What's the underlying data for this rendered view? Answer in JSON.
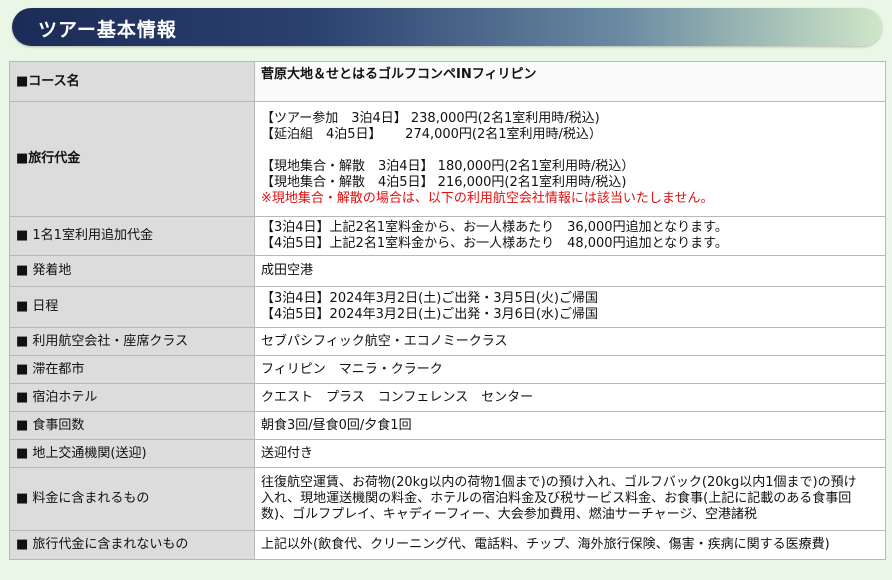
{
  "header": {
    "title": "ツアー基本情報"
  },
  "rows": {
    "course": {
      "label": "■コース名",
      "value": "菅原大地＆せとはるゴルフコンペINフィリピン"
    },
    "price": {
      "label": "■旅行代金",
      "lines": [
        "【ツアー参加　3泊4日】 238,000円(2名1室利用時/税込)",
        "【延泊組　4泊5日】　 　274,000円(2名1室利用時/税込）",
        "【現地集合・解散　3泊4日】 180,000円(2名1室利用時/税込）",
        "【現地集合・解散　4泊5日】 216,000円(2名1室利用時/税込)"
      ],
      "note": "※現地集合・解散の場合は、以下の利用航空会社情報には該当いたしません。"
    },
    "single": {
      "label": "■ 1名1室利用追加代金",
      "lines": [
        "【3泊4日】上記2名1室料金から、お一人様あたり　36,000円追加となります。",
        "【4泊5日】上記2名1室料金から、お一人様あたり　48,000円追加となります。"
      ]
    },
    "departure": {
      "label": "■ 発着地",
      "value": "成田空港"
    },
    "schedule": {
      "label": "■ 日程",
      "lines": [
        "【3泊4日】2024年3月2日(土)ご出発・3月5日(火)ご帰国",
        "【4泊5日】2024年3月2日(土)ご出発・3月6日(水)ご帰国"
      ]
    },
    "airline": {
      "label": "■ 利用航空会社・座席クラス",
      "value": "セブパシフィック航空・エコノミークラス"
    },
    "city": {
      "label": "■ 滞在都市",
      "value": "フィリピン　マニラ・クラーク"
    },
    "hotel": {
      "label": "■ 宿泊ホテル",
      "value": "クエスト　プラス　コンフェレンス　センター"
    },
    "meals": {
      "label": "■ 食事回数",
      "value": "朝食3回/昼食0回/夕食1回"
    },
    "transport": {
      "label": "■ 地上交通機関(送迎)",
      "value": "送迎付き"
    },
    "included": {
      "label": "■ 料金に含まれるもの",
      "lines": [
        "往復航空運賃、お荷物(20kg以内の荷物1個まで)の預け入れ、ゴルフバック(20kg以内1個まで)の預け",
        "入れ、現地運送機関の料金、ホテルの宿泊料金及び税サービス料金、お食事(上記に記載のある食事回",
        "数)、ゴルフプレイ、キャディーフィー、大会参加費用、燃油サーチャージ、空港諸税"
      ]
    },
    "excluded": {
      "label": "■ 旅行代金に含まれないもの",
      "value": "上記以外(飲食代、クリーニング代、電話料、チップ、海外旅行保険、傷害・疾病に関する医療費)"
    }
  }
}
